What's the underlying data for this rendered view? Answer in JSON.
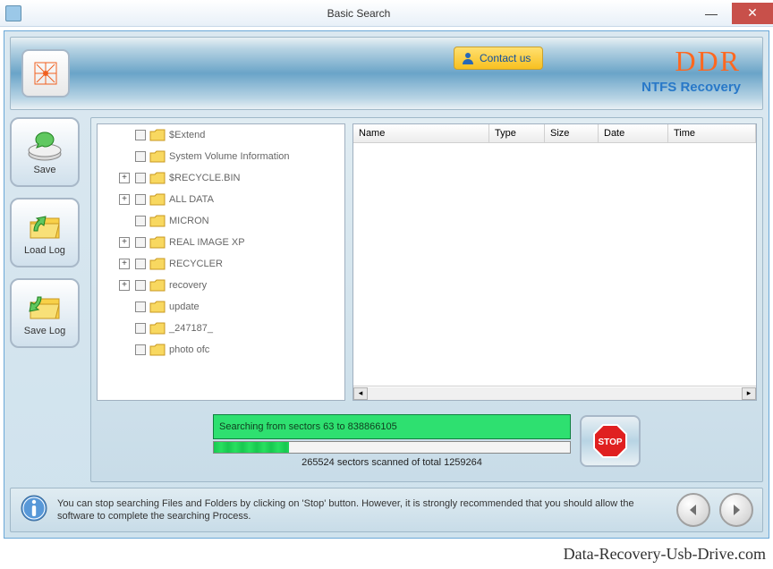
{
  "window": {
    "title": "Basic Search"
  },
  "header": {
    "contact_label": "Contact us",
    "brand": "DDR",
    "brand_sub": "NTFS Recovery"
  },
  "side": {
    "save": "Save",
    "load_log": "Load Log",
    "save_log": "Save Log"
  },
  "tree": {
    "items": [
      {
        "label": "$Extend",
        "expandable": false
      },
      {
        "label": "System Volume Information",
        "expandable": false
      },
      {
        "label": "$RECYCLE.BIN",
        "expandable": true
      },
      {
        "label": "ALL DATA",
        "expandable": true
      },
      {
        "label": "MICRON",
        "expandable": false
      },
      {
        "label": "REAL IMAGE XP",
        "expandable": true
      },
      {
        "label": "RECYCLER",
        "expandable": true
      },
      {
        "label": "recovery",
        "expandable": true
      },
      {
        "label": "update",
        "expandable": false
      },
      {
        "label": "_247187_",
        "expandable": false
      },
      {
        "label": "photo ofc",
        "expandable": false
      }
    ]
  },
  "columns": {
    "c0": "Name",
    "c1": "Type",
    "c2": "Size",
    "c3": "Date",
    "c4": "Time"
  },
  "progress": {
    "searching_label": "Searching from sectors 63 to 838866105",
    "status": "265524  sectors scanned of total 1259264",
    "percent": 21
  },
  "info": {
    "text": "You can stop searching Files and Folders by clicking on 'Stop' button. However, it is strongly recommended that you should allow the software to complete the searching Process."
  },
  "watermark": "Data-Recovery-Usb-Drive.com",
  "colors": {
    "accent_orange": "#ff6820",
    "accent_blue": "#2878c8",
    "progress_green": "#2ee070"
  }
}
